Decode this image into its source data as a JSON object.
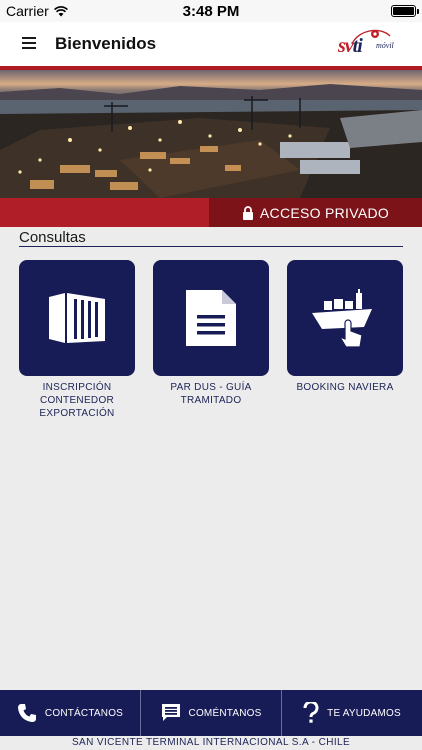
{
  "status": {
    "carrier": "Carrier",
    "time": "3:48 PM",
    "icons": [
      "wifi-icon",
      "battery-icon"
    ]
  },
  "nav": {
    "title": "Bienvenidos",
    "menu_icon": "hamburger-menu-icon",
    "logo": {
      "text_main": "svti",
      "text_sub": "móvil"
    }
  },
  "hero": {
    "image": "port-terminal-night-photo",
    "access_label": "ACCESO PRIVADO",
    "access_icon": "lock-icon"
  },
  "section": {
    "title": "Consultas",
    "tiles": [
      {
        "label": "INSCRIPCIÓN CONTENEDOR EXPORTACIÓN",
        "icon": "container-icon"
      },
      {
        "label": "PAR DUS - GUÍA TRAMITADO",
        "icon": "document-icon"
      },
      {
        "label": "BOOKING NAVIERA",
        "icon": "ship-touch-icon"
      }
    ]
  },
  "bottom_bar": [
    {
      "label": "CONTÁCTANOS",
      "icon": "phone-icon"
    },
    {
      "label": "COMÉNTANOS",
      "icon": "comment-icon"
    },
    {
      "label": "TE AYUDAMOS",
      "icon": "question-icon"
    }
  ],
  "footer": "SAN VICENTE TERMINAL INTERNACIONAL S.A - CHILE",
  "colors": {
    "brand_navy": "#181c56",
    "brand_red": "#b01e27",
    "brand_dark_red": "#7c1318",
    "background": "#ececec"
  }
}
